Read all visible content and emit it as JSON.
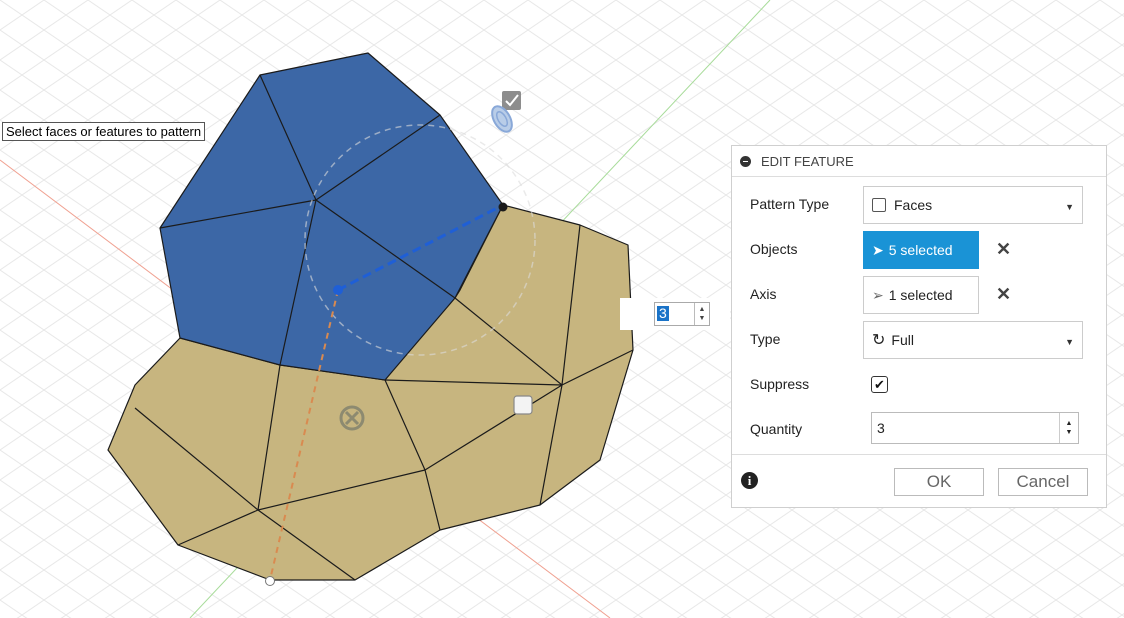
{
  "viewport": {
    "tooltip": "Select faces or features to pattern",
    "quantity_overlay": {
      "value": "3",
      "rotate_icon": "rotate-icon"
    },
    "colors": {
      "selected_faces": "#3c67a6",
      "body_faces": "#c7b57f",
      "edge": "#1b1b1b"
    }
  },
  "panel": {
    "title": "EDIT FEATURE",
    "rows": {
      "pattern_type": {
        "label": "Pattern Type",
        "value": "Faces"
      },
      "objects": {
        "label": "Objects",
        "value": "5 selected"
      },
      "axis": {
        "label": "Axis",
        "value": "1 selected"
      },
      "type": {
        "label": "Type",
        "value": "Full"
      },
      "suppress": {
        "label": "Suppress",
        "checked": true
      },
      "quantity": {
        "label": "Quantity",
        "value": "3"
      }
    },
    "buttons": {
      "ok": "OK",
      "cancel": "Cancel"
    },
    "accent": "#1a93d6"
  }
}
